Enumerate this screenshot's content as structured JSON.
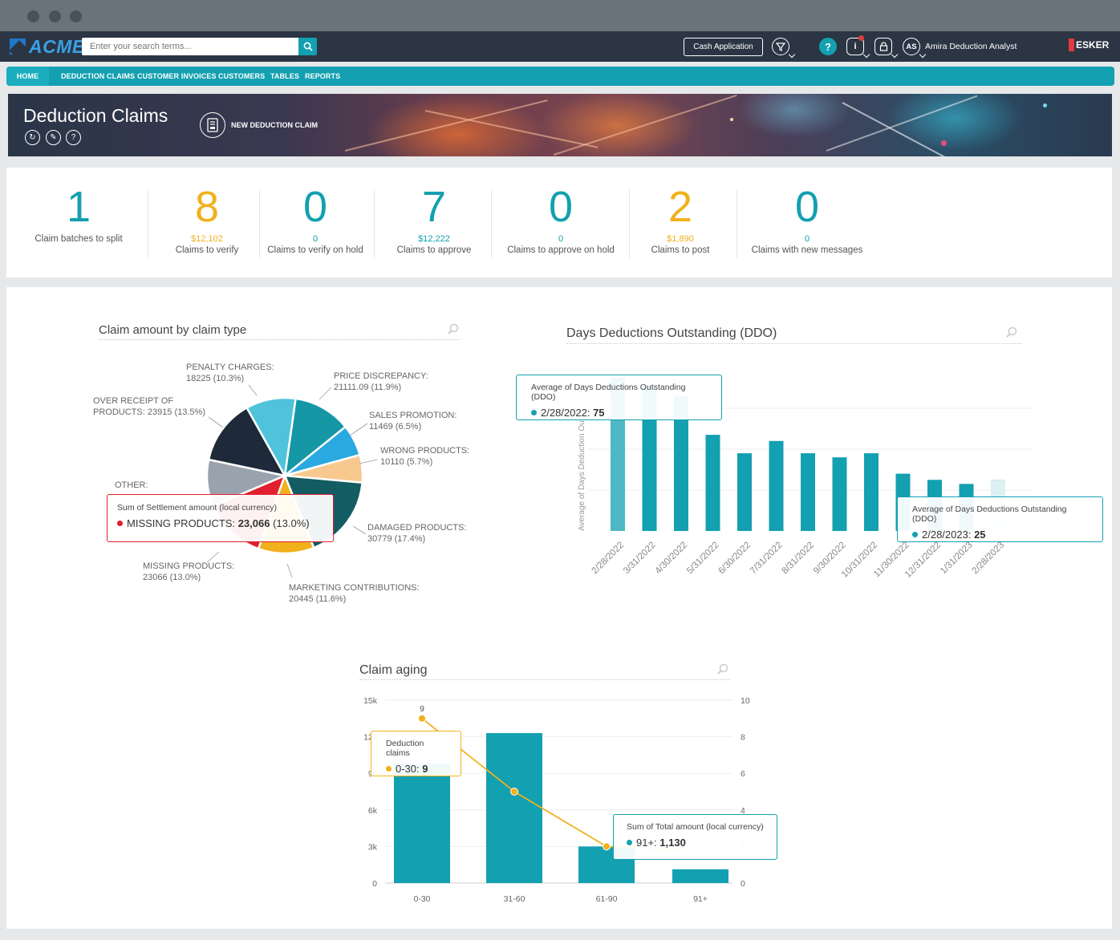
{
  "header": {
    "logo_text": "ACME",
    "search_placeholder": "Enter your search terms...",
    "cash_application_label": "Cash Application",
    "user_initials": "AS",
    "user_name": "Amira Deduction Analyst",
    "brand_text": "ESKER"
  },
  "nav": {
    "items": [
      "HOME",
      "DEDUCTION CLAIMS",
      "CUSTOMER INVOICES",
      "CUSTOMERS",
      "TABLES",
      "REPORTS"
    ]
  },
  "banner": {
    "title": "Deduction Claims",
    "new_claim_label": "NEW DEDUCTION CLAIM"
  },
  "kpis": [
    {
      "value": "1",
      "sub": "",
      "label": "Claim batches to split",
      "color": "teal"
    },
    {
      "value": "8",
      "sub": "$12,102",
      "label": "Claims to verify",
      "color": "gold"
    },
    {
      "value": "0",
      "sub": "0",
      "label": "Claims to verify on hold",
      "color": "teal"
    },
    {
      "value": "7",
      "sub": "$12,222",
      "label": "Claims to approve",
      "color": "teal"
    },
    {
      "value": "0",
      "sub": "0",
      "label": "Claims to approve on hold",
      "color": "teal"
    },
    {
      "value": "2",
      "sub": "$1,890",
      "label": "Claims to post",
      "color": "gold"
    },
    {
      "value": "0",
      "sub": "0",
      "label": "Claims with new messages",
      "color": "teal"
    }
  ],
  "colors": {
    "teal": "#13a0b0",
    "gold": "#f1b11c",
    "header_bg": "#2b3544",
    "red": "#e13a3a"
  },
  "chart_data": [
    {
      "type": "pie",
      "title": "Claim amount by claim type",
      "slices": [
        {
          "label": "PRICE DISCREPANCY",
          "value": 21111.09,
          "pct": "11.9%",
          "text": "PRICE DISCREPANCY: 21111.09 (11.9%)",
          "color": "#1597a6"
        },
        {
          "label": "SALES PROMOTION",
          "value": 11469,
          "pct": "6.5%",
          "text": "SALES PROMOTION: 11469 (6.5%)",
          "color": "#2aa8e0"
        },
        {
          "label": "WRONG PRODUCTS",
          "value": 10110,
          "pct": "5.7%",
          "text": "WRONG PRODUCTS: 10110 (5.7%)",
          "color": "#f8c98e"
        },
        {
          "label": "DAMAGED PRODUCTS",
          "value": 30779,
          "pct": "17.4%",
          "text": "DAMAGED PRODUCTS: 30779 (17.4%)",
          "color": "#135c62"
        },
        {
          "label": "MARKETING CONTRIBUTIONS",
          "value": 20445,
          "pct": "11.6%",
          "text": "MARKETING CONTRIBUTIONS: 20445 (11.6%)",
          "color": "#f1b11c"
        },
        {
          "label": "MISSING PRODUCTS",
          "value": 23066,
          "pct": "13.0%",
          "text": "MISSING PRODUCTS: 23066 (13.0%)",
          "color": "#e21f2e"
        },
        {
          "label": "OTHER",
          "value": 17074,
          "pct": "",
          "text": "OTHER:",
          "color": "#9aa3ad"
        },
        {
          "label": "OVER RECEIPT OF PRODUCTS",
          "value": 23915,
          "pct": "13.5%",
          "text": "OVER RECEIPT OF PRODUCTS: 23915 (13.5%)",
          "color": "#1e2a3a"
        },
        {
          "label": "PENALTY CHARGES",
          "value": 18225,
          "pct": "10.3%",
          "text": "PENALTY CHARGES: 18225 (10.3%)",
          "color": "#4fc3da"
        }
      ],
      "tooltip": {
        "header": "Sum of Settlement amount (local currency)",
        "label": "MISSING PRODUCTS: ",
        "value": "23,066",
        "pct": " (13.0%)"
      }
    },
    {
      "type": "bar",
      "title": "Days Deductions Outstanding (DDO)",
      "ylabel": "Average of Days Deduction Out",
      "categories": [
        "2/28/2022",
        "3/31/2022",
        "4/30/2022",
        "5/31/2022",
        "6/30/2022",
        "7/31/2022",
        "8/31/2022",
        "9/30/2022",
        "10/31/2022",
        "11/30/2022",
        "12/31/2022",
        "1/31/2023",
        "2/28/2023"
      ],
      "values": [
        75,
        71,
        66,
        47,
        38,
        44,
        38,
        36,
        38,
        28,
        25,
        23,
        25
      ],
      "tooltips": [
        {
          "header": "Average of Days Deductions Outstanding (DDO)",
          "label": "2/28/2022: ",
          "value": "75"
        },
        {
          "header": "Average of Days Deductions Outstanding (DDO)",
          "label": "2/28/2023: ",
          "value": "25"
        }
      ]
    },
    {
      "type": "bar",
      "title": "Claim aging",
      "categories": [
        "0-30",
        "31-60",
        "61-90",
        "91+"
      ],
      "series": [
        {
          "name": "Sum of Total amount (local currency)",
          "values": [
            9800,
            12300,
            3000,
            1130
          ],
          "axis": "left"
        },
        {
          "name": "Deduction claims",
          "values": [
            9,
            5,
            2
          ],
          "axis": "right"
        }
      ],
      "ylim_left": [
        0,
        15000
      ],
      "ylim_right": [
        0,
        10
      ],
      "left_ticks": [
        "0",
        "3k",
        "6k",
        "9k",
        "12k",
        "15k"
      ],
      "right_ticks": [
        "0",
        "2",
        "4",
        "6",
        "8",
        "10"
      ],
      "point_label": "9",
      "tooltips": [
        {
          "header": "Deduction claims",
          "label": "0-30: ",
          "value": "9"
        },
        {
          "header": "Sum of Total amount (local currency)",
          "label": "91+: ",
          "value": "1,130"
        }
      ]
    }
  ]
}
